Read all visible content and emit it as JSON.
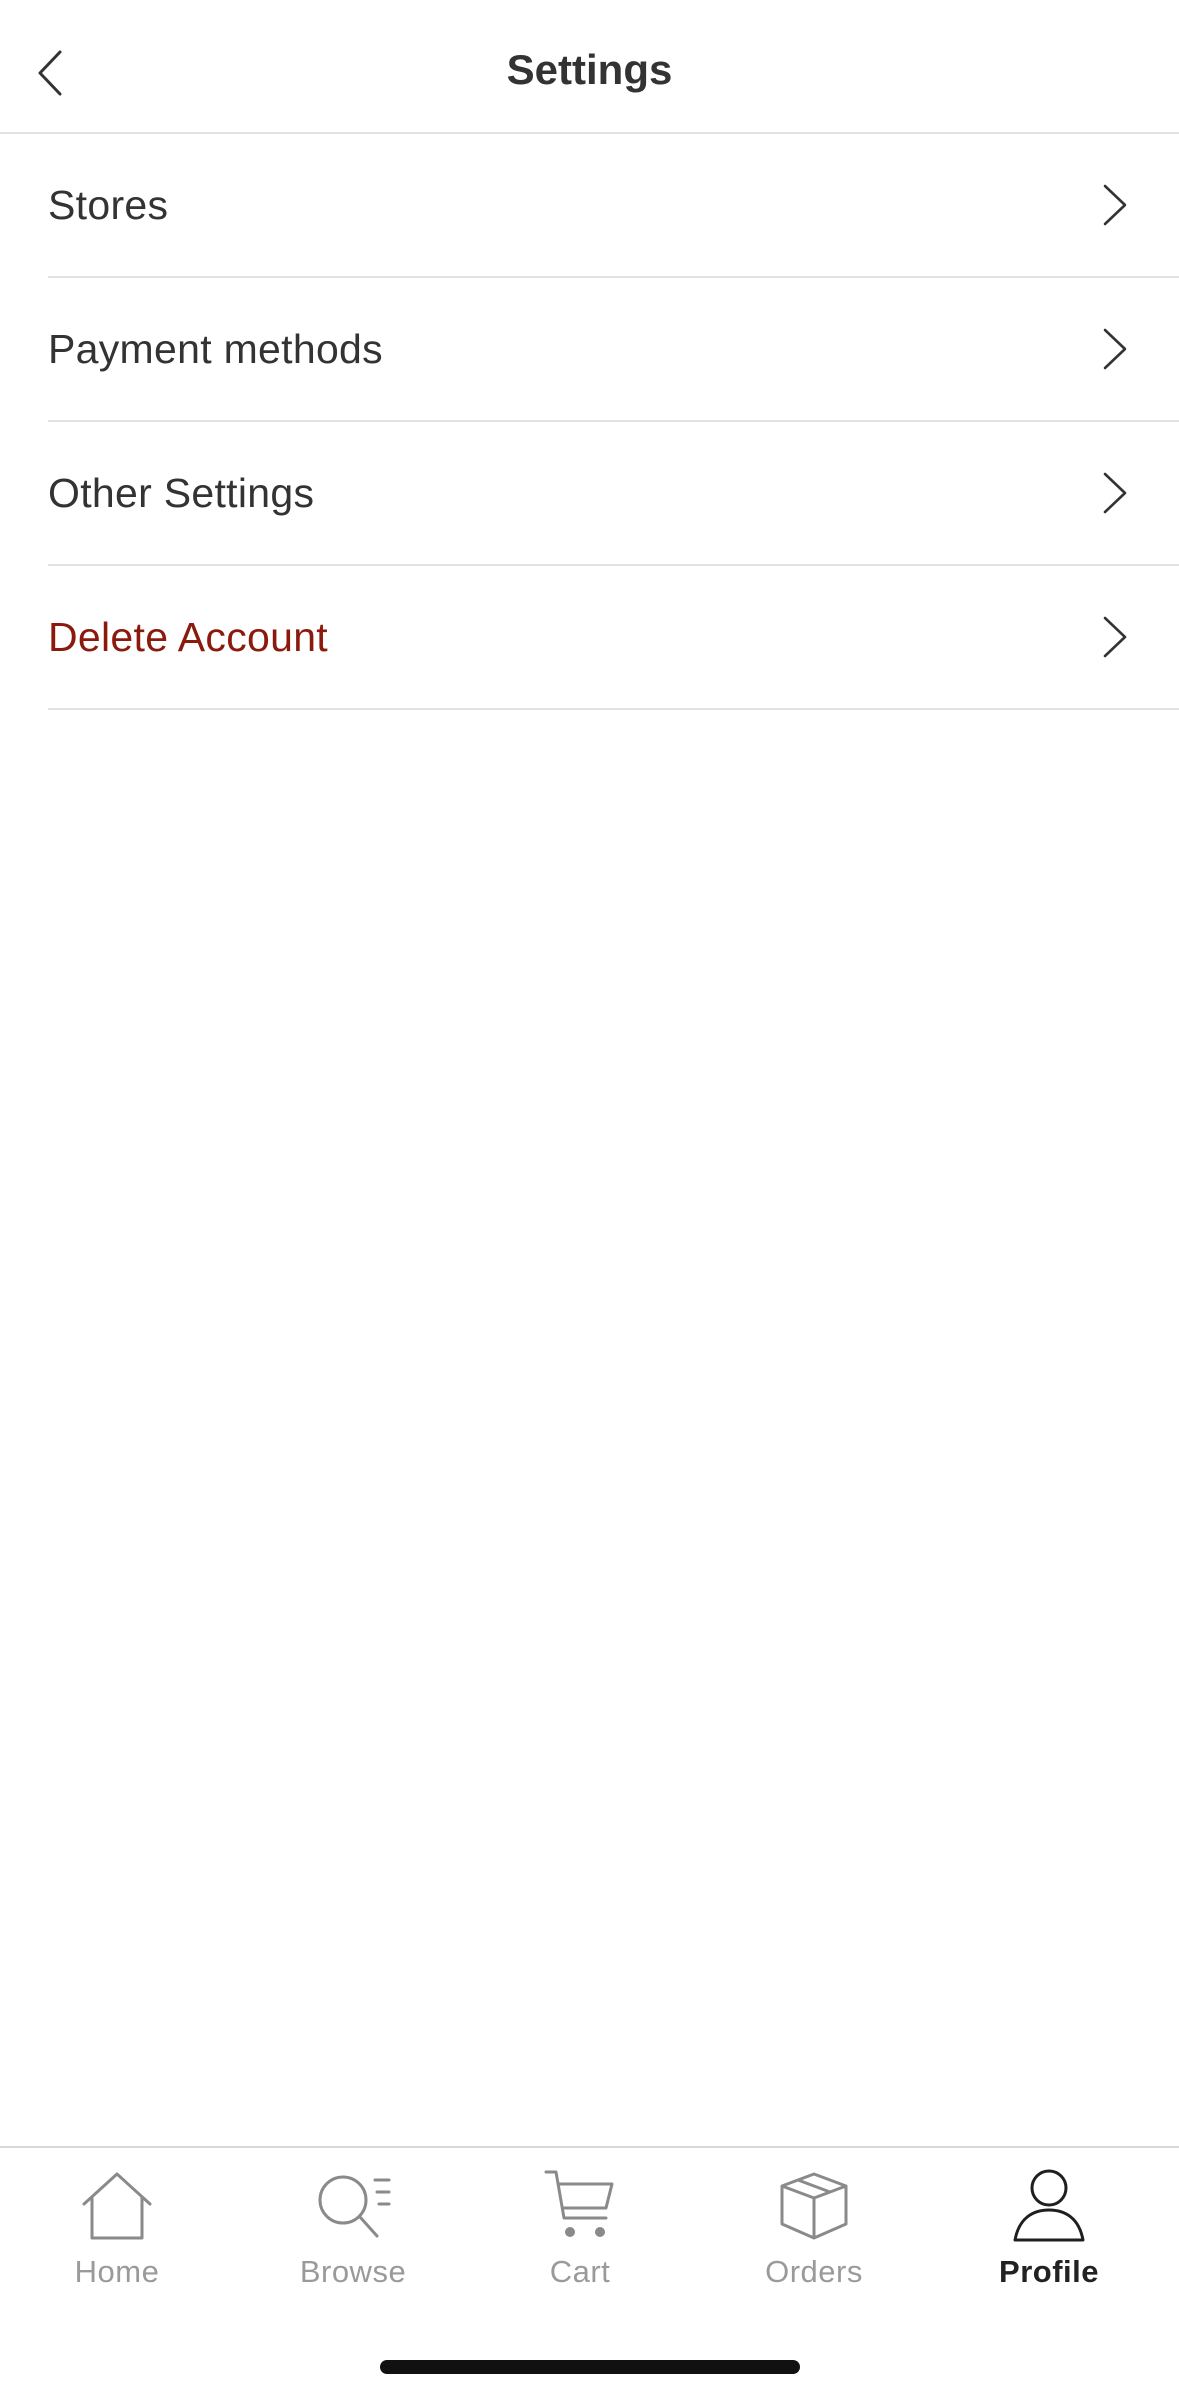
{
  "header": {
    "title": "Settings",
    "back_icon": "chevron-left-icon"
  },
  "settings": {
    "items": [
      {
        "label": "Stores",
        "icon": "chevron-right-icon"
      },
      {
        "label": "Payment methods",
        "icon": "chevron-right-icon"
      },
      {
        "label": "Other Settings",
        "icon": "chevron-right-icon"
      },
      {
        "label": "Delete Account",
        "icon": "chevron-right-icon",
        "color": "#8b1a0e"
      }
    ]
  },
  "tab_bar": {
    "active": "Profile",
    "tabs": [
      {
        "label": "Home",
        "icon": "home-icon"
      },
      {
        "label": "Browse",
        "icon": "browse-search-icon"
      },
      {
        "label": "Cart",
        "icon": "cart-icon"
      },
      {
        "label": "Orders",
        "icon": "box-icon"
      },
      {
        "label": "Profile",
        "icon": "person-icon"
      }
    ]
  },
  "colors": {
    "text": "#333333",
    "danger": "#8b1a0e",
    "inactive_tab": "#9a9a9a",
    "divider": "#e2e2e2"
  }
}
